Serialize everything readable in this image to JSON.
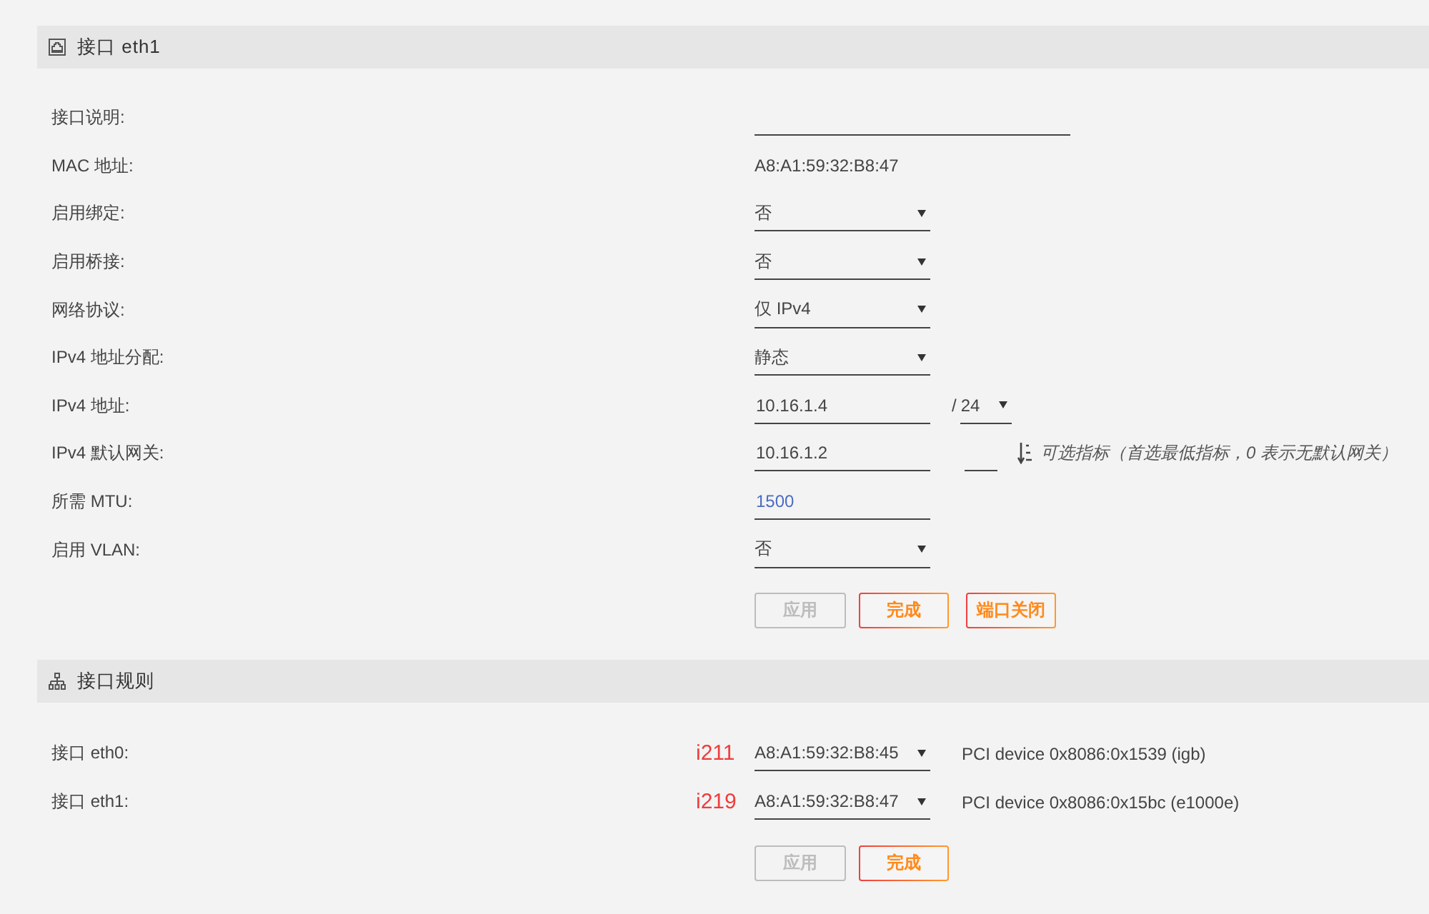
{
  "interface_section": {
    "title": "接口 eth1",
    "fields": [
      {
        "kind": "long_input",
        "label": "接口说明:"
      },
      {
        "kind": "text",
        "label": "MAC 地址:",
        "value": "A8:A1:59:32:B8:47"
      },
      {
        "kind": "select",
        "label": "启用绑定:",
        "value": "否"
      },
      {
        "kind": "select",
        "label": "启用桥接:",
        "value": "否"
      },
      {
        "kind": "select",
        "label": "网络协议:",
        "value": "仅 IPv4"
      },
      {
        "kind": "select",
        "label": "IPv4 地址分配:",
        "value": "静态"
      },
      {
        "kind": "address",
        "label": "IPv4 地址:",
        "value": "10.16.1.4",
        "separator": "/",
        "prefix": "24"
      },
      {
        "kind": "gateway",
        "label": "IPv4 默认网关:",
        "value": "10.16.1.2",
        "hint": "可选指标（首选最低指标，0 表示无默认网关）"
      },
      {
        "kind": "input",
        "label": "所需 MTU:",
        "placeholder": "1500"
      },
      {
        "kind": "select",
        "label": "启用 VLAN:",
        "value": "否"
      }
    ],
    "buttons": [
      {
        "label": "应用",
        "disabled": true
      },
      {
        "label": "完成",
        "disabled": false
      },
      {
        "label": "端口关闭",
        "disabled": false
      }
    ]
  },
  "rules_section": {
    "title": "接口规则",
    "rules": [
      {
        "label": "接口 eth0:",
        "tag": "i211",
        "value": "A8:A1:59:32:B8:45",
        "device": "PCI device 0x8086:0x1539 (igb)"
      },
      {
        "label": "接口 eth1:",
        "tag": "i219",
        "value": "A8:A1:59:32:B8:47",
        "device": "PCI device 0x8086:0x15bc (e1000e)"
      }
    ],
    "buttons": [
      {
        "label": "应用",
        "disabled": true
      },
      {
        "label": "完成",
        "disabled": false
      }
    ]
  }
}
